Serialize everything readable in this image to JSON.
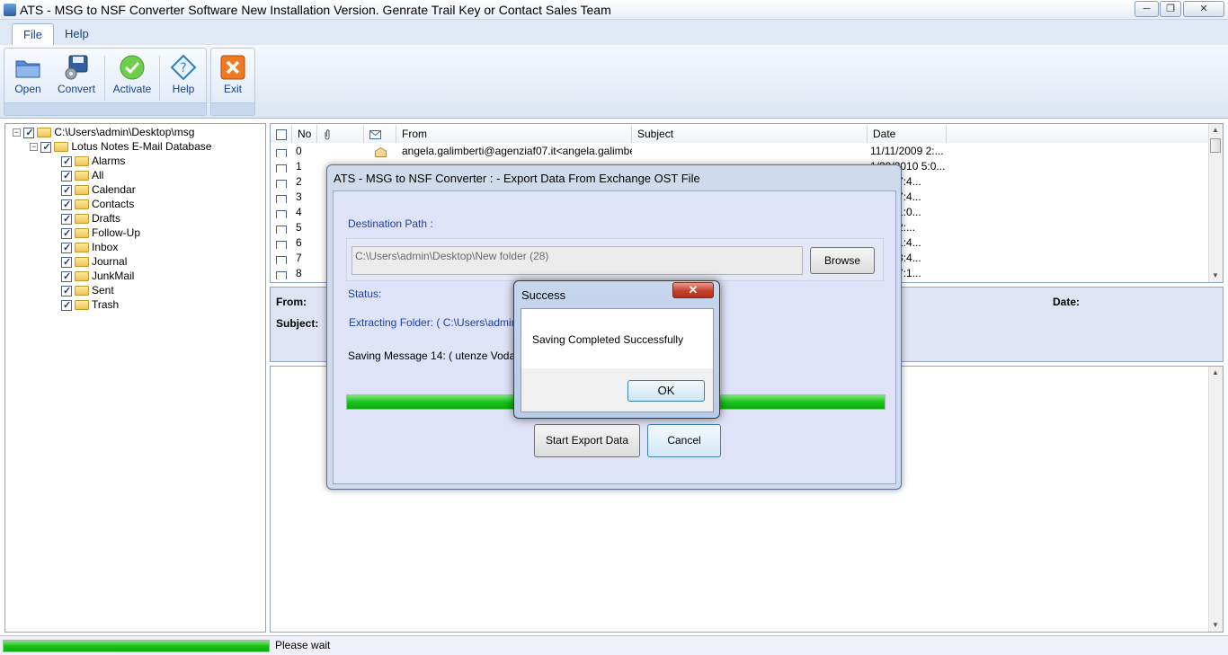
{
  "window": {
    "title": "ATS - MSG to NSF Converter Software New Installation Version. Genrate Trail Key or Contact Sales Team",
    "controls": [
      "─",
      "❐",
      "✕"
    ]
  },
  "ribbon": {
    "tabs": [
      "File",
      "Help"
    ],
    "buttons": {
      "open": "Open",
      "convert": "Convert",
      "activate": "Activate",
      "help": "Help",
      "exit": "Exit"
    }
  },
  "tree": {
    "root": "C:\\Users\\admin\\Desktop\\msg",
    "database": "Lotus Notes E-Mail Database",
    "folders": [
      "Alarms",
      "All",
      "Calendar",
      "Contacts",
      "Drafts",
      "Follow-Up",
      "Inbox",
      "Journal",
      "JunkMail",
      "Sent",
      "Trash"
    ]
  },
  "list": {
    "headers": {
      "no": "No",
      "from": "From",
      "subject": "Subject",
      "date": "Date"
    },
    "rows": [
      {
        "no": "0",
        "from": "angela.galimberti@agenziaf07.it<angela.galimberti...",
        "subject": "",
        "date": "11/11/2009 2:..."
      },
      {
        "no": "1",
        "from": "",
        "subject": "",
        "date": "1/29/2010 5:0..."
      },
      {
        "no": "2",
        "from": "",
        "subject": "",
        "date": "2010 7:4..."
      },
      {
        "no": "3",
        "from": "",
        "subject": "",
        "date": "2010 7:4..."
      },
      {
        "no": "4",
        "from": "",
        "subject": "",
        "date": "2009 1:0..."
      },
      {
        "no": "5",
        "from": "",
        "subject": "",
        "date": "2009 2:..."
      },
      {
        "no": "6",
        "from": "",
        "subject": "",
        "date": "2010 1:4..."
      },
      {
        "no": "7",
        "from": "",
        "subject": "",
        "date": "2010 3:4..."
      },
      {
        "no": "8",
        "from": "",
        "subject": "",
        "date": "2009 7:1..."
      }
    ]
  },
  "preview": {
    "from_label": "From:",
    "subject_label": "Subject:",
    "date_label": "Date:"
  },
  "status": {
    "text": "Please wait",
    "progress": 1.0
  },
  "export_dialog": {
    "title": "ATS - MSG to NSF Converter : - Export Data From Exchange OST File",
    "destination_label": "Destination Path :",
    "destination_value": "C:\\Users\\admin\\Desktop\\New folder (28)",
    "browse": "Browse",
    "status_label": "Status:",
    "extracting": "Extracting Folder: ( C:\\Users\\admin\\De",
    "saving": "Saving Message 14: ( utenze Vodafor",
    "progress": 1.0,
    "start": "Start Export Data",
    "cancel": "Cancel"
  },
  "success_dialog": {
    "title": "Success",
    "close": "✕",
    "message": "Saving Completed Successfully",
    "ok": "OK"
  },
  "colors": {
    "accent": "#15428b",
    "progress_green": "#19c319",
    "dialog_bg": "#dfe3f7"
  }
}
